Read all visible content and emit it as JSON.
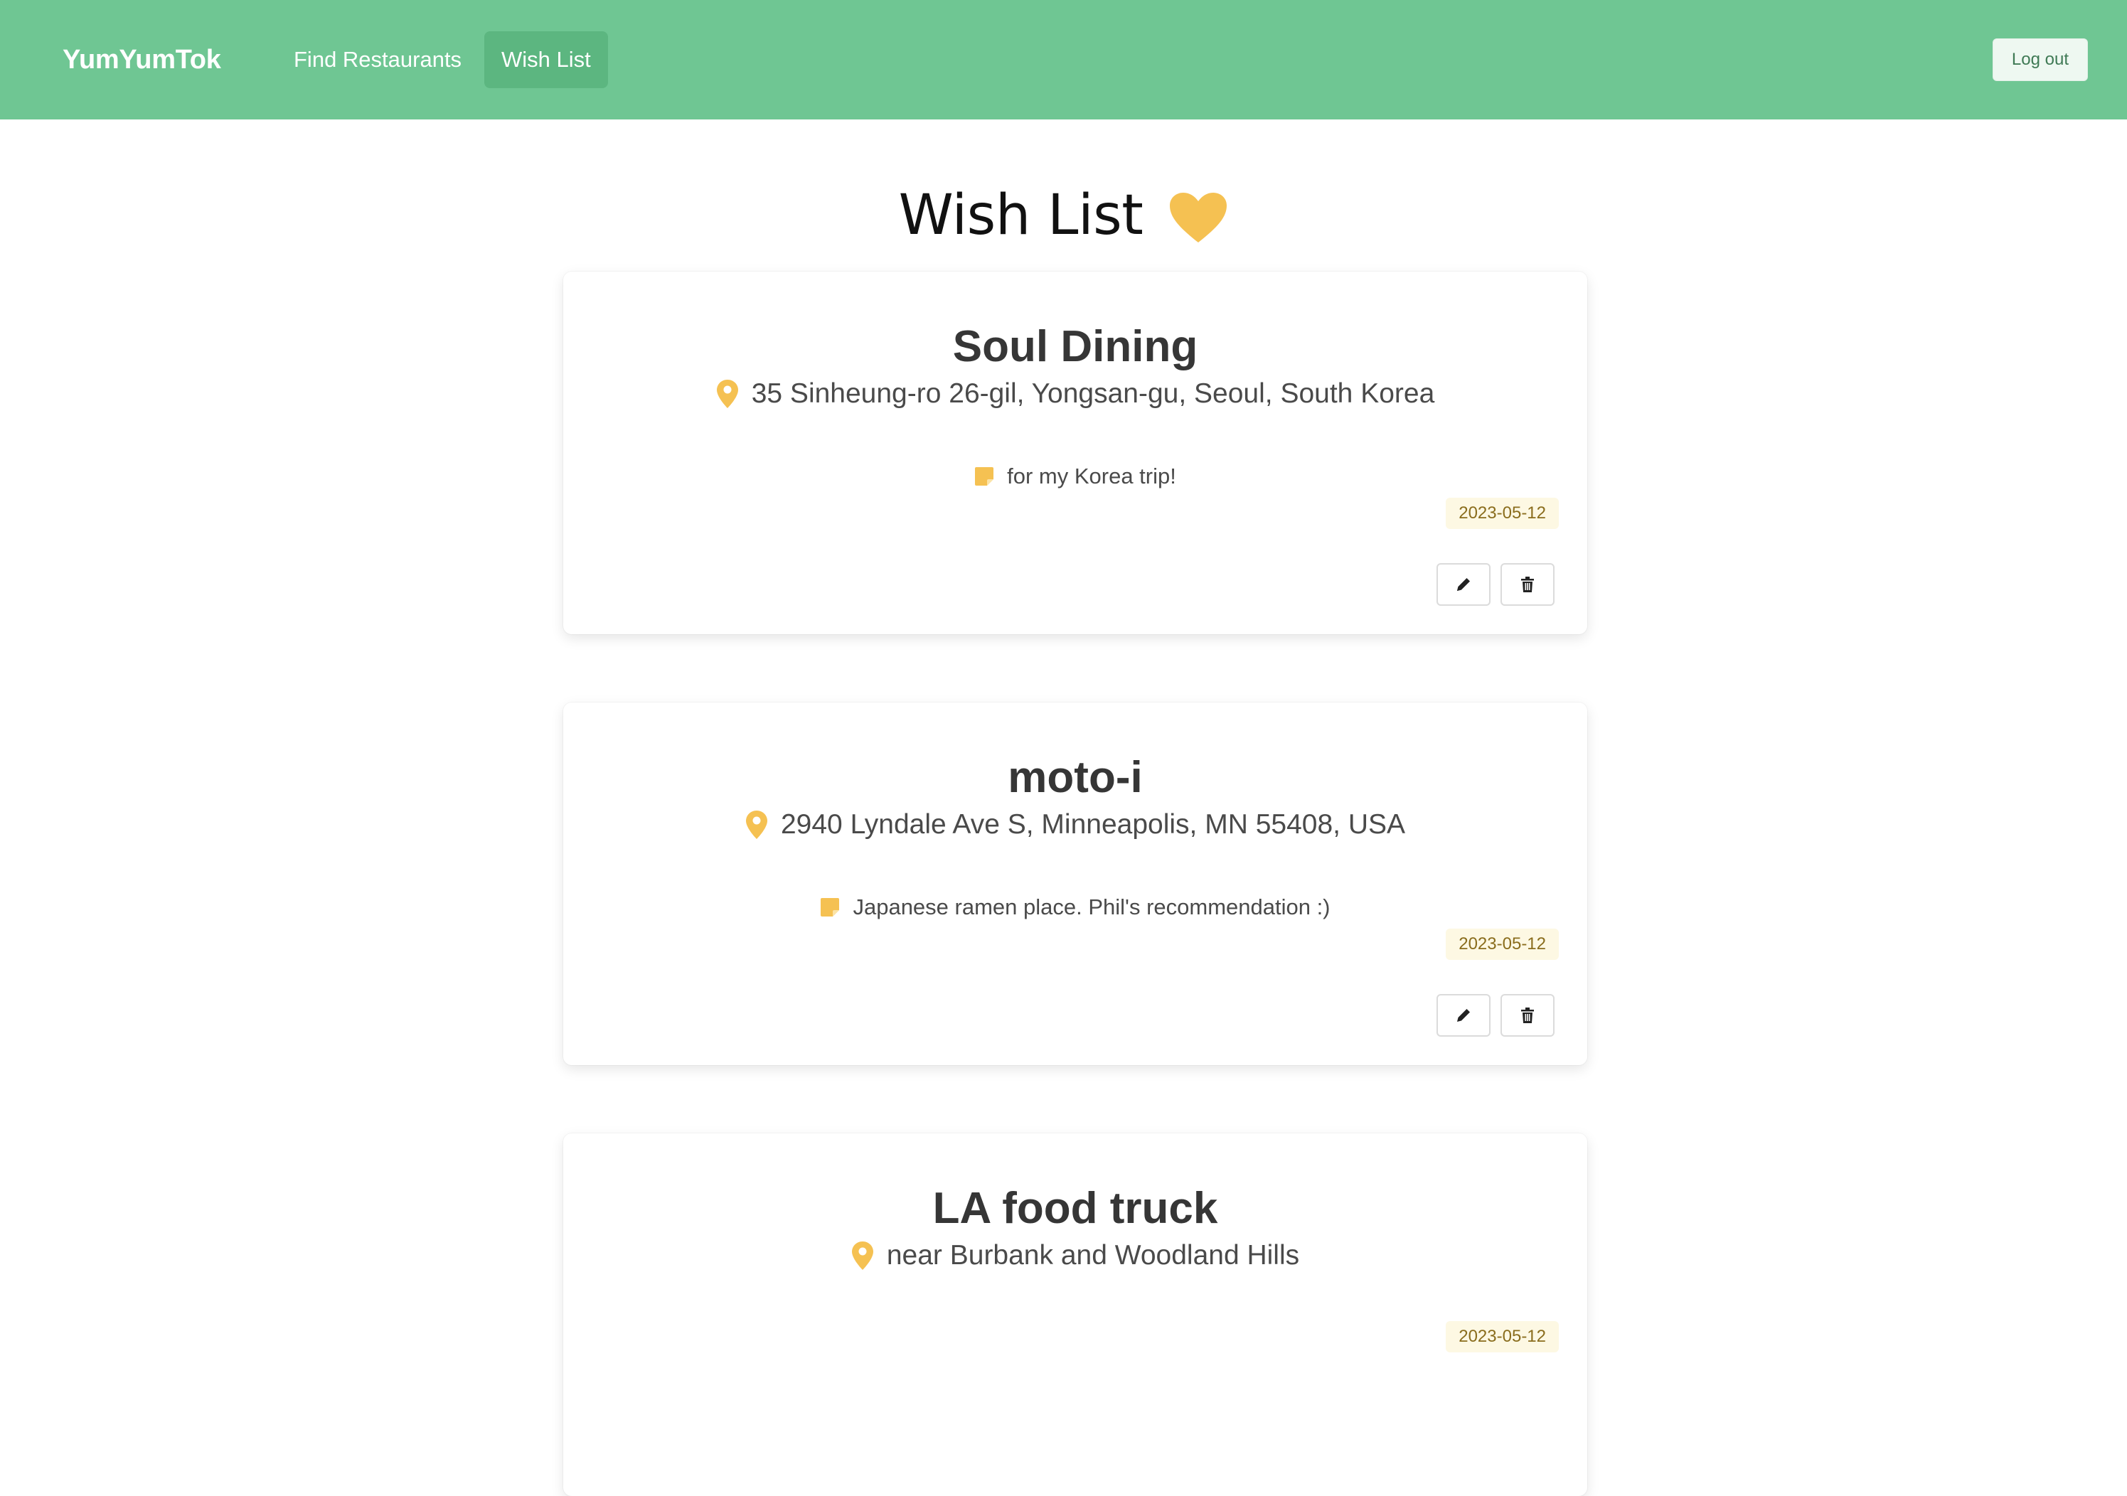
{
  "navbar": {
    "brand": "YumYumTok",
    "items": [
      {
        "label": "Find Restaurants",
        "active": false
      },
      {
        "label": "Wish List",
        "active": true
      }
    ],
    "logout_label": "Log out",
    "background": "#6fc693"
  },
  "page": {
    "title": "Wish List",
    "title_icon": "heart-icon",
    "accent": "#f5c152"
  },
  "wishlist": [
    {
      "name": "Soul Dining",
      "address": "35 Sinheung-ro 26-gil, Yongsan-gu, Seoul, South Korea",
      "note": "for my Korea trip!",
      "date": "2023-05-12",
      "address_icon": "map-pin-icon",
      "note_icon": "sticky-note-icon",
      "actions": [
        "pencil-icon",
        "trash-icon"
      ]
    },
    {
      "name": "moto-i",
      "address": "2940 Lyndale Ave S, Minneapolis, MN 55408, USA",
      "note": "Japanese ramen place. Phil's recommendation :)",
      "date": "2023-05-12",
      "address_icon": "map-pin-icon",
      "note_icon": "sticky-note-icon",
      "actions": [
        "pencil-icon",
        "trash-icon"
      ]
    },
    {
      "name": "LA food truck",
      "address": "near Burbank and Woodland Hills",
      "note": "",
      "date": "2023-05-12",
      "address_icon": "map-pin-icon",
      "note_icon": "",
      "actions": []
    }
  ]
}
